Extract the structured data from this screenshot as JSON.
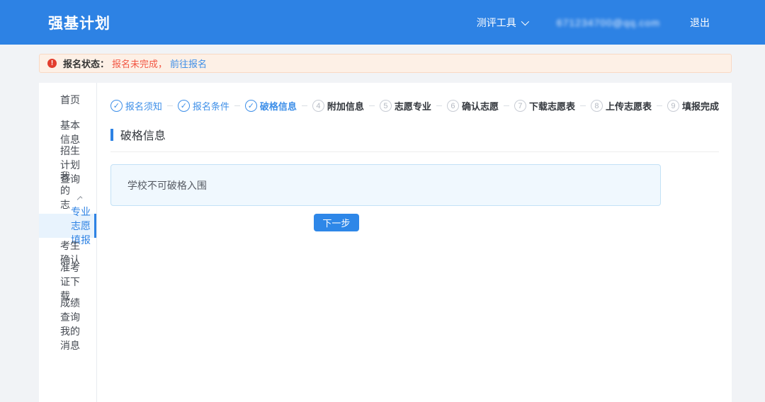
{
  "header": {
    "title": "强基计划",
    "tools_label": "测评工具",
    "user_email": "671234700@qq.com",
    "logout_label": "退出"
  },
  "alert": {
    "label": "报名状态：",
    "status_text": "报名未完成，",
    "link_text": "前往报名"
  },
  "sidebar": {
    "items": [
      {
        "label": "首页"
      },
      {
        "label": "基本信息"
      },
      {
        "label": "招生计划查询"
      },
      {
        "label": "我的志愿",
        "expanded": true
      },
      {
        "label": "考生确认"
      },
      {
        "label": "准考证下载"
      },
      {
        "label": "成绩查询"
      },
      {
        "label": "我的消息"
      }
    ],
    "submenu": [
      {
        "label": "专业志愿填报",
        "selected": true
      }
    ]
  },
  "stepper": {
    "check_glyph": "✓",
    "steps": [
      {
        "label": "报名须知",
        "state": "done"
      },
      {
        "label": "报名条件",
        "state": "done"
      },
      {
        "label": "破格信息",
        "state": "current"
      },
      {
        "num": "4",
        "label": "附加信息",
        "state": "pending"
      },
      {
        "num": "5",
        "label": "志愿专业",
        "state": "pending"
      },
      {
        "num": "6",
        "label": "确认志愿",
        "state": "pending"
      },
      {
        "num": "7",
        "label": "下载志愿表",
        "state": "pending"
      },
      {
        "num": "8",
        "label": "上传志愿表",
        "state": "pending"
      },
      {
        "num": "9",
        "label": "填报完成",
        "state": "pending"
      }
    ]
  },
  "main": {
    "section_title": "破格信息",
    "notice_text": "学校不可破格入围",
    "next_button_label": "下一步"
  },
  "colors": {
    "brand_blue": "#2d82e4",
    "link_blue": "#3e8fe8",
    "alert_bg": "#fdf0e6",
    "alert_border": "#f9d9c4",
    "alert_status_red": "#f25643",
    "alert_icon_red": "#e23d2e",
    "notice_bg": "#f0f8fe",
    "notice_border": "#c3e1f6",
    "selected_item_bg": "#e8f3fd",
    "page_bg": "#f1f3f6"
  }
}
